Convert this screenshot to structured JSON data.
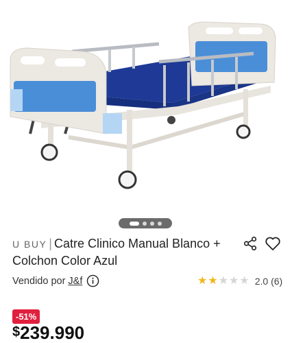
{
  "product": {
    "brand": "U BUY",
    "separator": "|",
    "title": "Catre Clinico Manual Blanco + Colchon Color Azul",
    "image_alt": "hospital-bed-photo"
  },
  "carousel": {
    "total": 4,
    "active": 0
  },
  "seller": {
    "label": "Vendido por",
    "name": "J&f"
  },
  "rating": {
    "value": 2,
    "max": 5,
    "text": "2.0",
    "count": "(6)"
  },
  "pricing": {
    "discount": "-51%",
    "currency": "$",
    "amount": "239.990"
  },
  "colors": {
    "accent_red": "#e0203d",
    "star": "#f2b61d",
    "mattress": "#1f3e9a",
    "panel_blue": "#4a8ed8"
  }
}
